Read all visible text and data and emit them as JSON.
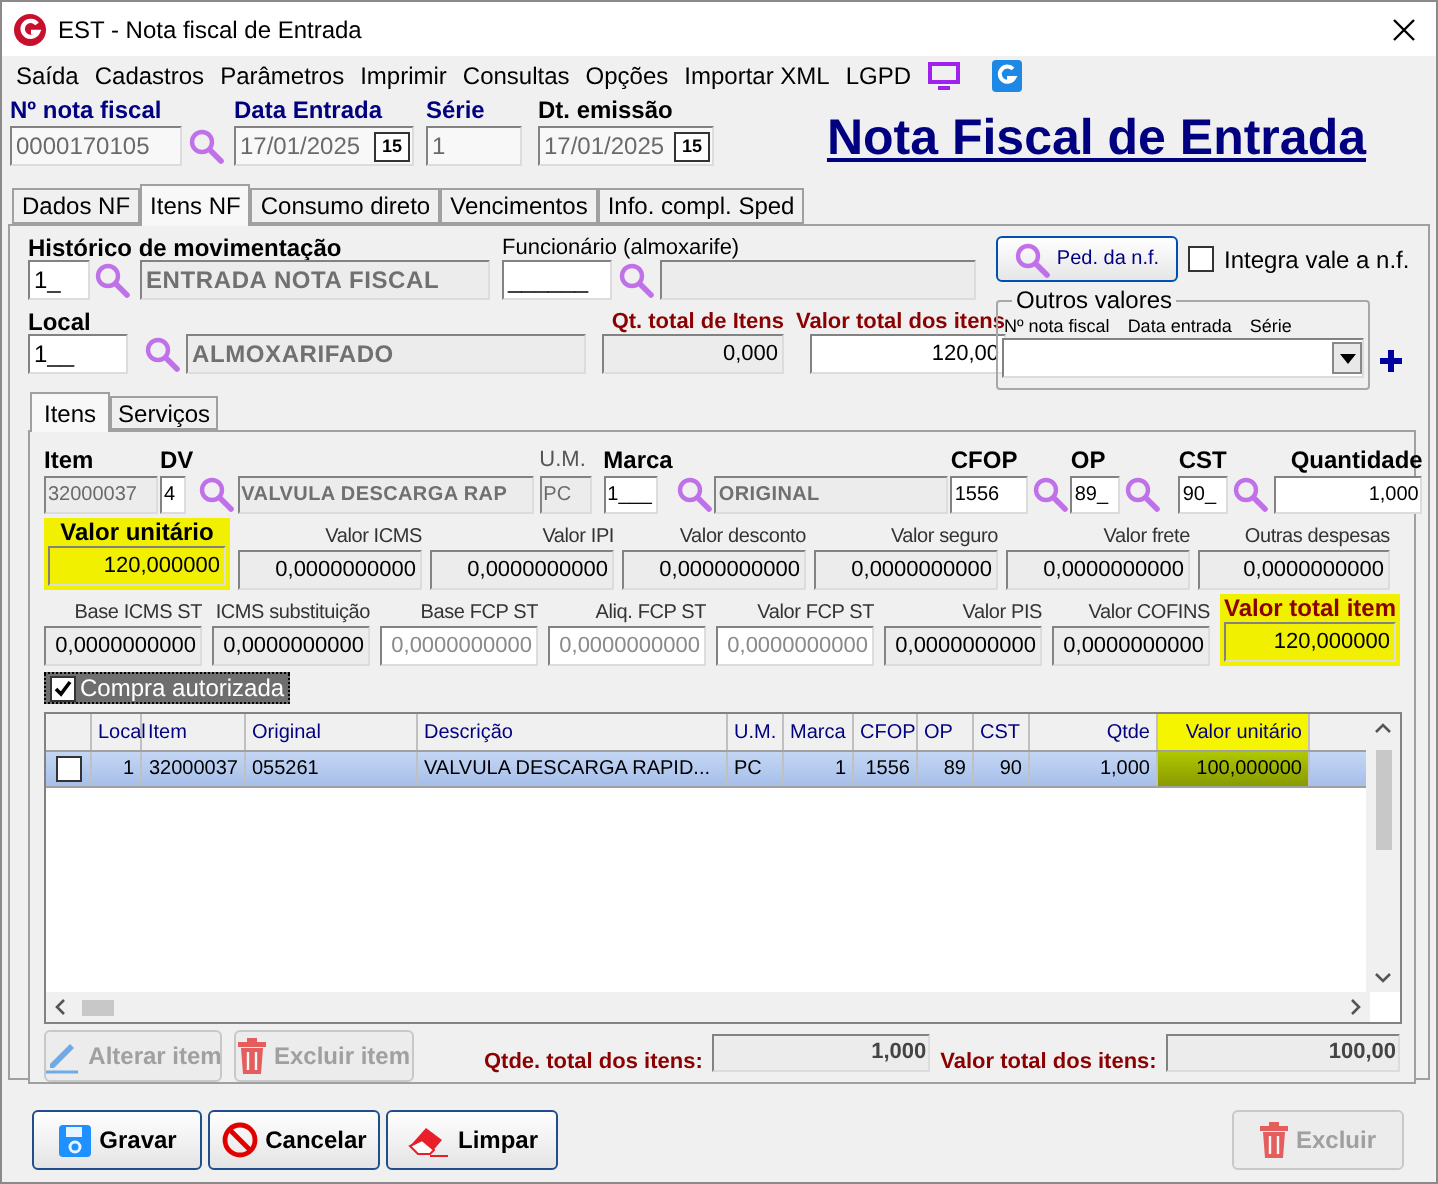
{
  "window": {
    "title": "EST - Nota fiscal de Entrada"
  },
  "menu": [
    {
      "label": "Saída"
    },
    {
      "label": "Cadastros"
    },
    {
      "label": "Parâmetros"
    },
    {
      "label": "Imprimir"
    },
    {
      "label": "Consultas"
    },
    {
      "label": "Opções"
    },
    {
      "label": "Importar XML"
    },
    {
      "label": "LGPD"
    }
  ],
  "header": {
    "fields": [
      {
        "kind": "search",
        "label": "Nº nota fiscal",
        "value": "0000170105",
        "color": "#000080"
      },
      {
        "kind": "date",
        "label": "Data Entrada",
        "value": "17/01/2025",
        "calendar_text": "15",
        "color": "#000080"
      },
      {
        "kind": "text",
        "label": "Série",
        "value": "1",
        "color": "#000080"
      },
      {
        "kind": "date",
        "label": "Dt. emissão",
        "value": "17/01/2025",
        "calendar_text": "15",
        "color": "#000000"
      }
    ],
    "heading": "Nota Fiscal de Entrada"
  },
  "tabs": [
    {
      "label": "Dados NF",
      "selected": false
    },
    {
      "label": "Itens NF",
      "selected": true
    },
    {
      "label": "Consumo direto",
      "selected": false
    },
    {
      "label": "Vencimentos",
      "selected": false
    },
    {
      "label": "Info. compl. Sped",
      "selected": false
    }
  ],
  "movement": {
    "label": "Histórico de movimentação",
    "code": "1_",
    "description": "ENTRADA NOTA FISCAL"
  },
  "employee": {
    "label": "Funcionário (almoxarife)",
    "code": "______"
  },
  "order_button": {
    "label": "Ped. da n.f."
  },
  "integrate": {
    "label": "Integra vale a n.f.",
    "checked": false
  },
  "location": {
    "label": "Local",
    "code": "1__",
    "description": "ALMOXARIFADO"
  },
  "totals": [
    {
      "label": "Qt. total de Itens",
      "value": "0,000",
      "disabled": true
    },
    {
      "label": "Valor total dos itens",
      "value": "120,00",
      "disabled": false
    }
  ],
  "other_values": {
    "legend": "Outros valores",
    "columns": [
      "Nº nota fiscal",
      "Data entrada",
      "Série"
    ]
  },
  "subtabs": [
    {
      "label": "Itens",
      "selected": true
    },
    {
      "label": "Serviços",
      "selected": false
    }
  ],
  "item_fields": [
    {
      "label": "Item",
      "value": "32000037",
      "disabled": true,
      "required": true
    },
    {
      "label": "DV",
      "value": "4",
      "disabled": false,
      "required": true,
      "search": true
    },
    {
      "value": "VALVULA DESCARGA RAP",
      "disabled": true
    },
    {
      "label": "U.M.",
      "value": "PC",
      "disabled": true,
      "required": false
    },
    {
      "label": "Marca",
      "value": "1___",
      "disabled": false,
      "required": true,
      "search": true
    },
    {
      "value": "ORIGINAL",
      "disabled": true
    },
    {
      "label": "CFOP",
      "value": "1556",
      "disabled": false,
      "required": true,
      "search": true
    },
    {
      "label": "OP",
      "value": "89_",
      "disabled": false,
      "required": true,
      "search": true
    },
    {
      "label": "CST",
      "value": "90_",
      "disabled": false,
      "required": true,
      "search": true
    },
    {
      "label": "Quantidade",
      "value": "1,000",
      "disabled": false,
      "required": true
    }
  ],
  "value_rows": [
    [
      {
        "label": "Valor unitário",
        "value": "120,000000",
        "kind": "key",
        "disabled": false,
        "highlighted": true
      },
      {
        "label": "Valor ICMS",
        "value": "0,0000000000",
        "kind": "plain",
        "disabled": true,
        "highlighted": false
      },
      {
        "label": "Valor IPI",
        "value": "0,0000000000",
        "kind": "plain",
        "disabled": true,
        "highlighted": false
      },
      {
        "label": "Valor desconto",
        "value": "0,0000000000",
        "kind": "plain",
        "disabled": true,
        "highlighted": false
      },
      {
        "label": "Valor seguro",
        "value": "0,0000000000",
        "kind": "plain",
        "disabled": true,
        "highlighted": false
      },
      {
        "label": "Valor frete",
        "value": "0,0000000000",
        "kind": "plain",
        "disabled": true,
        "highlighted": false
      },
      {
        "label": "Outras despesas",
        "value": "0,0000000000",
        "kind": "plain",
        "disabled": true,
        "highlighted": false
      }
    ],
    [
      {
        "label": "Base ICMS ST",
        "value": "0,0000000000",
        "kind": "plain",
        "disabled": true,
        "highlighted": false
      },
      {
        "label": "ICMS substituição",
        "value": "0,0000000000",
        "kind": "plain",
        "disabled": true,
        "highlighted": false
      },
      {
        "label": "Base FCP ST",
        "value": "0,0000000000",
        "kind": "plain",
        "disabled": false,
        "highlighted": false
      },
      {
        "label": "Aliq. FCP ST",
        "value": "0,0000000000",
        "kind": "plain",
        "disabled": false,
        "highlighted": false
      },
      {
        "label": "Valor FCP ST",
        "value": "0,0000000000",
        "kind": "plain",
        "disabled": false,
        "highlighted": false
      },
      {
        "label": "Valor PIS",
        "value": "0,0000000000",
        "kind": "plain",
        "disabled": true,
        "highlighted": false
      },
      {
        "label": "Valor COFINS",
        "value": "0,0000000000",
        "kind": "plain",
        "disabled": true,
        "highlighted": false
      },
      {
        "label": "Valor total item",
        "value": "120,000000",
        "kind": "total",
        "disabled": false,
        "highlighted": true
      }
    ]
  ],
  "authorized": {
    "label": "Compra autorizada",
    "checked": true
  },
  "grid": {
    "columns": [
      {
        "label": "Local",
        "highlighted": false
      },
      {
        "label": "Item",
        "highlighted": false
      },
      {
        "label": "Original",
        "highlighted": false
      },
      {
        "label": "Descrição",
        "highlighted": false
      },
      {
        "label": "U.M.",
        "highlighted": false
      },
      {
        "label": "Marca",
        "highlighted": false
      },
      {
        "label": "CFOP",
        "highlighted": false
      },
      {
        "label": "OP",
        "highlighted": false
      },
      {
        "label": "CST",
        "highlighted": false
      },
      {
        "label": "Qtde",
        "highlighted": false
      },
      {
        "label": "Valor unitário",
        "highlighted": true
      }
    ],
    "rows": [
      {
        "selected": true,
        "checked": false,
        "cells": [
          "1",
          "32000037",
          "055261",
          "VALVULA DESCARGA RAPID...",
          "PC",
          "1",
          "1556",
          "89",
          "90",
          "1,000",
          "100,000000"
        ]
      }
    ]
  },
  "item_buttons": [
    {
      "kind": "edit",
      "label": "Alterar item",
      "disabled": true
    },
    {
      "kind": "delete",
      "label": "Excluir item",
      "disabled": true
    }
  ],
  "item_totals": [
    {
      "label": "Qtde. total dos itens:",
      "value": "1,000"
    },
    {
      "label": "Valor total dos itens:",
      "value": "100,00"
    }
  ],
  "footer_buttons": [
    {
      "kind": "save",
      "label": "Gravar",
      "disabled": false
    },
    {
      "kind": "cancel",
      "label": "Cancelar",
      "disabled": false
    },
    {
      "kind": "clear",
      "label": "Limpar",
      "disabled": false
    },
    {
      "kind": "delete",
      "label": "Excluir",
      "disabled": true
    }
  ]
}
